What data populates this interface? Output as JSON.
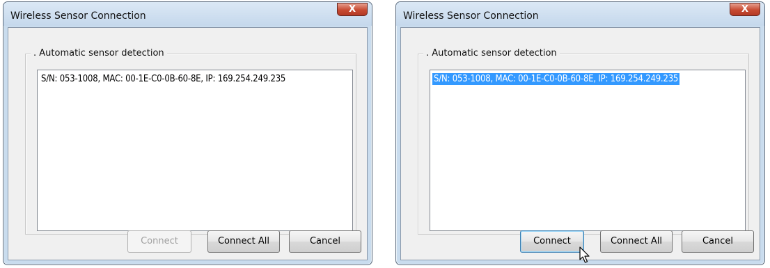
{
  "dialogs": [
    {
      "title": "Wireless Sensor Connection",
      "close_glyph": "X",
      "group_label": ".  Automatic sensor detection",
      "list_items": [
        {
          "text": "S/N: 053-1008, MAC: 00-1E-C0-0B-60-8E, IP: 169.254.249.235",
          "selected": false
        }
      ],
      "buttons": {
        "connect": {
          "label": "Connect",
          "enabled": false
        },
        "connect_all": {
          "label": "Connect All",
          "enabled": true
        },
        "cancel": {
          "label": "Cancel",
          "enabled": true
        }
      }
    },
    {
      "title": "Wireless Sensor Connection",
      "close_glyph": "X",
      "group_label": ".  Automatic sensor detection",
      "list_items": [
        {
          "text": "S/N: 053-1008, MAC: 00-1E-C0-0B-60-8E, IP: 169.254.249.235",
          "selected": true
        }
      ],
      "buttons": {
        "connect": {
          "label": "Connect",
          "enabled": true
        },
        "connect_all": {
          "label": "Connect All",
          "enabled": true
        },
        "cancel": {
          "label": "Cancel",
          "enabled": true
        }
      },
      "pointer": "arrow-cursor-icon"
    }
  ],
  "colors": {
    "selection": "#3399ff",
    "close_button": "#c74a32",
    "window_frame": "#c9dcee"
  }
}
